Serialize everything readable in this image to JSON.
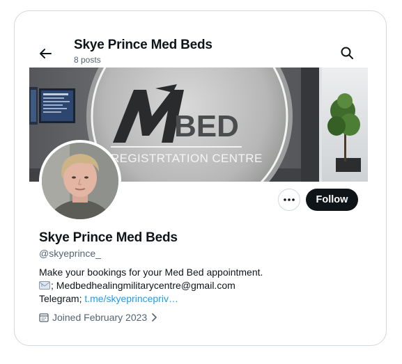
{
  "header": {
    "title": "Skye Prince Med Beds",
    "post_count": "8 posts"
  },
  "banner": {
    "logo_letter": "M",
    "logo_word": "BED",
    "subtitle": "REGISTRTATION CENTRE"
  },
  "profile": {
    "name": "Skye Prince Med Beds",
    "handle": "@skyeprince_",
    "follow_label": "Follow",
    "bio_line1": "Make your bookings for your Med Bed appointment.",
    "bio_email": "; Medbedhealingmilitarycentre@gmail.com",
    "bio_telegram_prefix": "Telegram; ",
    "bio_telegram_link": "t.me/skyeprincepriv…",
    "joined": "Joined February 2023"
  },
  "icons": {
    "back": "arrow-left-icon",
    "search": "search-icon",
    "more": "more-horizontal-icon",
    "mail": "envelope-icon",
    "calendar": "calendar-icon",
    "chevron": "chevron-right-icon"
  },
  "colors": {
    "primary_text": "#0f1419",
    "secondary_text": "#536471",
    "link": "#1d9bf0",
    "border": "#cfd9de",
    "follow_bg": "#0f1419"
  }
}
